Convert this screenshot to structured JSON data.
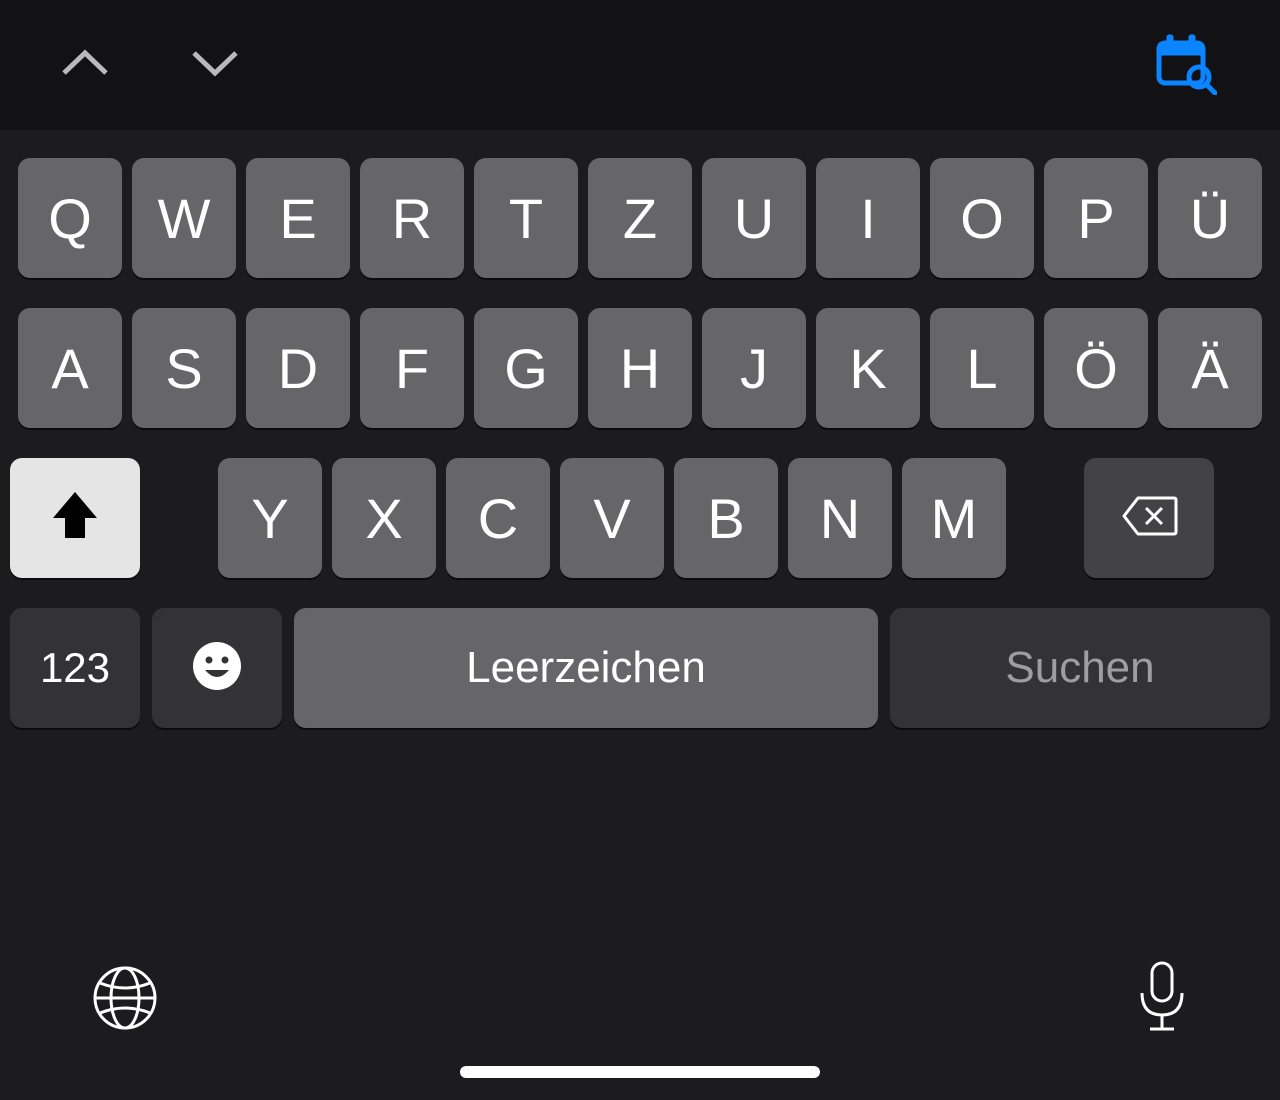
{
  "toolbar": {
    "prev_icon": "chevron-up",
    "next_icon": "chevron-down",
    "right_icon": "calendar-search"
  },
  "keyboard": {
    "row1": [
      "Q",
      "W",
      "E",
      "R",
      "T",
      "Z",
      "U",
      "I",
      "O",
      "P",
      "Ü"
    ],
    "row2": [
      "A",
      "S",
      "D",
      "F",
      "G",
      "H",
      "J",
      "K",
      "L",
      "Ö",
      "Ä"
    ],
    "row3": [
      "Y",
      "X",
      "C",
      "V",
      "B",
      "N",
      "M"
    ],
    "shift_active": true,
    "backspace_icon": "delete",
    "numbers_label": "123",
    "emoji_icon": "emoji",
    "space_label": "Leerzeichen",
    "action_label": "Suchen"
  },
  "bottom": {
    "globe_icon": "globe",
    "mic_icon": "microphone",
    "home_indicator": true
  }
}
